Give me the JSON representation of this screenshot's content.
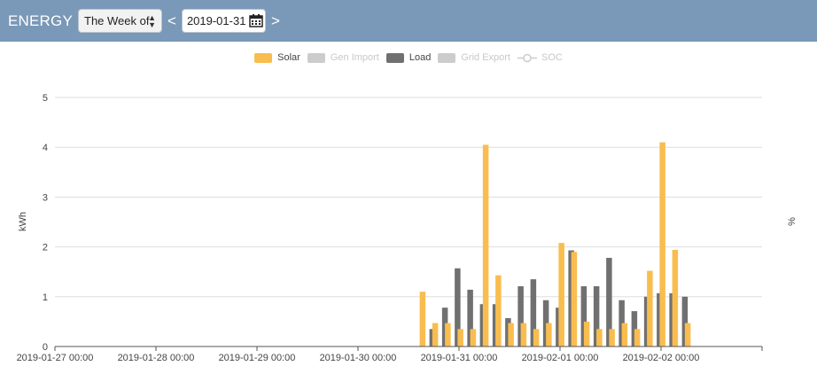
{
  "header": {
    "title": "ENERGY",
    "period_select": {
      "selected": "The Week of"
    },
    "prev_label": "<",
    "next_label": ">",
    "date_value": "2019-01-31"
  },
  "legend": [
    {
      "name": "Solar",
      "color": "#f9bd4f",
      "enabled": true,
      "marker": "box"
    },
    {
      "name": "Gen Import",
      "color": "#cccccc",
      "enabled": false,
      "marker": "box"
    },
    {
      "name": "Load",
      "color": "#707070",
      "enabled": true,
      "marker": "box"
    },
    {
      "name": "Grid Export",
      "color": "#cccccc",
      "enabled": false,
      "marker": "box"
    },
    {
      "name": "SOC",
      "color": "#cccccc",
      "enabled": false,
      "marker": "line-circle"
    }
  ],
  "chart_data": {
    "type": "bar",
    "ylabel": "kWh",
    "y2label": "%",
    "ylim": [
      0,
      5
    ],
    "yticks": [
      0,
      1,
      2,
      3,
      4,
      5
    ],
    "grid": true,
    "x_tick_labels": [
      "2019-01-27 00:00",
      "2019-01-28 00:00",
      "2019-01-29 00:00",
      "2019-01-30 00:00",
      "2019-01-31 00:00",
      "2019-02-01 00:00",
      "2019-02-02 00:00"
    ],
    "x_range": [
      "2019-01-27 00:00",
      "2019-02-03 00:00"
    ],
    "bin_hours": 3,
    "x": [
      "2019-01-30 15:00",
      "2019-01-30 18:00",
      "2019-01-30 21:00",
      "2019-01-31 00:00",
      "2019-01-31 03:00",
      "2019-01-31 06:00",
      "2019-01-31 09:00",
      "2019-01-31 12:00",
      "2019-01-31 15:00",
      "2019-01-31 18:00",
      "2019-01-31 21:00",
      "2019-02-01 00:00",
      "2019-02-01 03:00",
      "2019-02-01 06:00",
      "2019-02-01 09:00",
      "2019-02-01 12:00",
      "2019-02-01 15:00",
      "2019-02-01 18:00",
      "2019-02-01 21:00",
      "2019-02-02 00:00",
      "2019-02-02 03:00",
      "2019-02-02 06:00",
      "2019-02-02 09:00",
      "2019-02-02 12:00",
      "2019-02-02 15:00",
      "2019-02-02 18:00",
      "2019-02-02 21:00"
    ],
    "series": [
      {
        "name": "Solar",
        "color": "#f9bd4f",
        "values": [
          1.1,
          0.47,
          0.47,
          0.35,
          0.35,
          4.05,
          1.43,
          0.47,
          0.47,
          0.35,
          0.47,
          2.08,
          1.9,
          0.5,
          0.35,
          0.35,
          0.47,
          0.35,
          1.52,
          4.1,
          1.94,
          0.47
        ]
      },
      {
        "name": "Load",
        "color": "#707070",
        "values": [
          0.35,
          0.78,
          1.57,
          1.14,
          0.85,
          0.85,
          0.57,
          1.21,
          1.35,
          0.93,
          0.78,
          1.93,
          1.21,
          1.21,
          1.78,
          0.93,
          0.71,
          1.0,
          1.07,
          1.07,
          1.0
        ]
      }
    ]
  }
}
